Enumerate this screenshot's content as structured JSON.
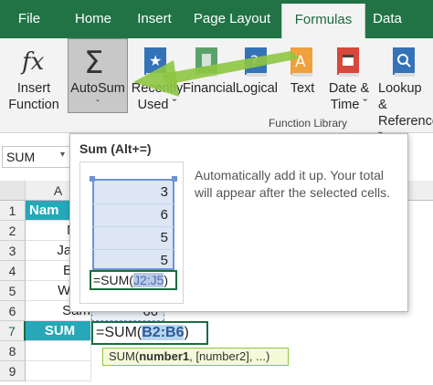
{
  "ribbon_tabs": [
    "File",
    "Home",
    "Insert",
    "Page Layout",
    "Formulas",
    "Data"
  ],
  "active_tab": "Formulas",
  "buttons": {
    "insert_function": {
      "line1": "Insert",
      "line2": "Function",
      "icon": "fx-icon"
    },
    "autosum": {
      "line1": "AutoSum",
      "line2": "ˇ",
      "icon": "sigma-icon"
    },
    "recently_used": {
      "line1": "Recently",
      "line2": "Used ˇ",
      "icon": "star-book-icon"
    },
    "financial": {
      "line1": "Financial",
      "icon": "book-icon"
    },
    "logical": {
      "line1": "Logical",
      "icon": "question-book-icon"
    },
    "text": {
      "line1": "Text",
      "icon": "a-book-icon"
    },
    "date_time": {
      "line1": "Date &",
      "line2": "Time ˇ",
      "icon": "calendar-book-icon"
    },
    "lookup": {
      "line1": "Lookup &",
      "line2": "Reference ˇ",
      "icon": "search-book-icon"
    }
  },
  "group_label": "Function Library",
  "name_box": "SUM",
  "grid": {
    "columns": [
      "A"
    ],
    "rows": [
      "1",
      "2",
      "3",
      "4",
      "5",
      "6",
      "7",
      "8",
      "9"
    ],
    "a_cells": [
      "Nam",
      "Mar",
      "Jame",
      "Bela",
      "Willia",
      "Sam",
      "SUM",
      "",
      ""
    ],
    "b6": "66",
    "formula_prefix": "=SUM(",
    "formula_ref": "B2:B6",
    "formula_suffix": ")",
    "arg_tip_fn": "SUM(",
    "arg_tip_bold": "number1",
    "arg_tip_rest": ", [number2], ...)"
  },
  "tooltip": {
    "title": "Sum (Alt+=)",
    "description": "Automatically add it up. Your total will appear after the selected cells.",
    "mini_values": [
      "3",
      "6",
      "5",
      "5"
    ],
    "mini_formula_prefix": "=SUM(",
    "mini_formula_ref": "J2:J5",
    "mini_formula_suffix": ")"
  },
  "colors": {
    "excel_green": "#217346",
    "teal": "#26a8b8",
    "arrow": "#8ec641"
  }
}
